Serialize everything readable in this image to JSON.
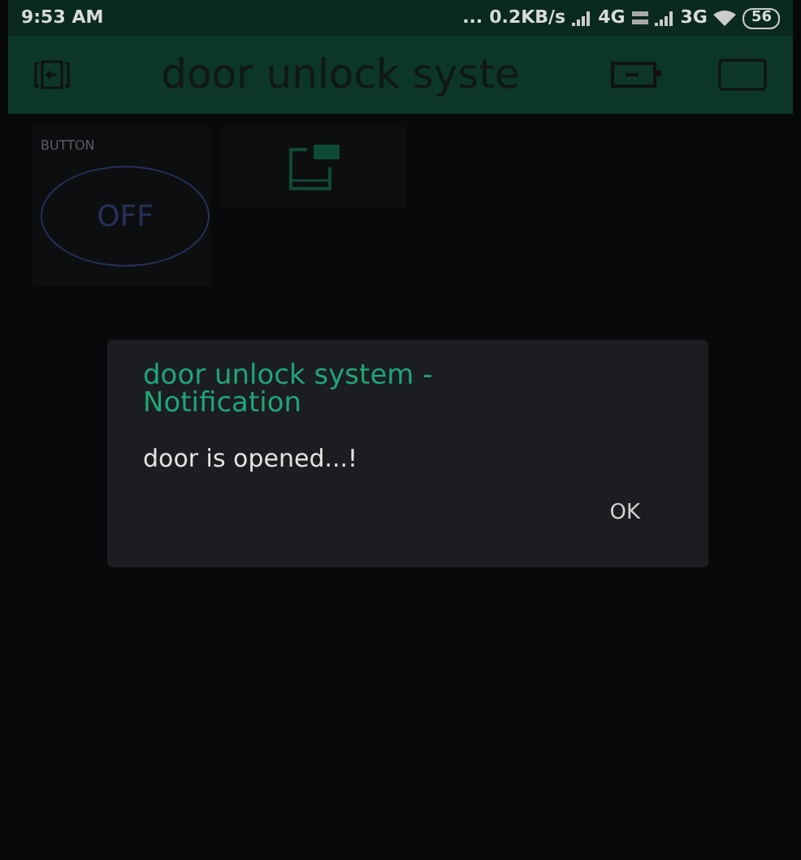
{
  "status_bar": {
    "time": "9:53 AM",
    "dots": "...",
    "speed": "0.2KB/s",
    "network_1": "4G",
    "network_2": "3G",
    "battery": "56"
  },
  "toolbar": {
    "title": "door unlock syste"
  },
  "widgets": [
    {
      "kind": "button",
      "label": "BUTTON",
      "value": "OFF"
    },
    {
      "kind": "notification"
    }
  ],
  "dialog": {
    "title": "door unlock system - Notification",
    "message": "door is opened...!",
    "button": "OK"
  }
}
